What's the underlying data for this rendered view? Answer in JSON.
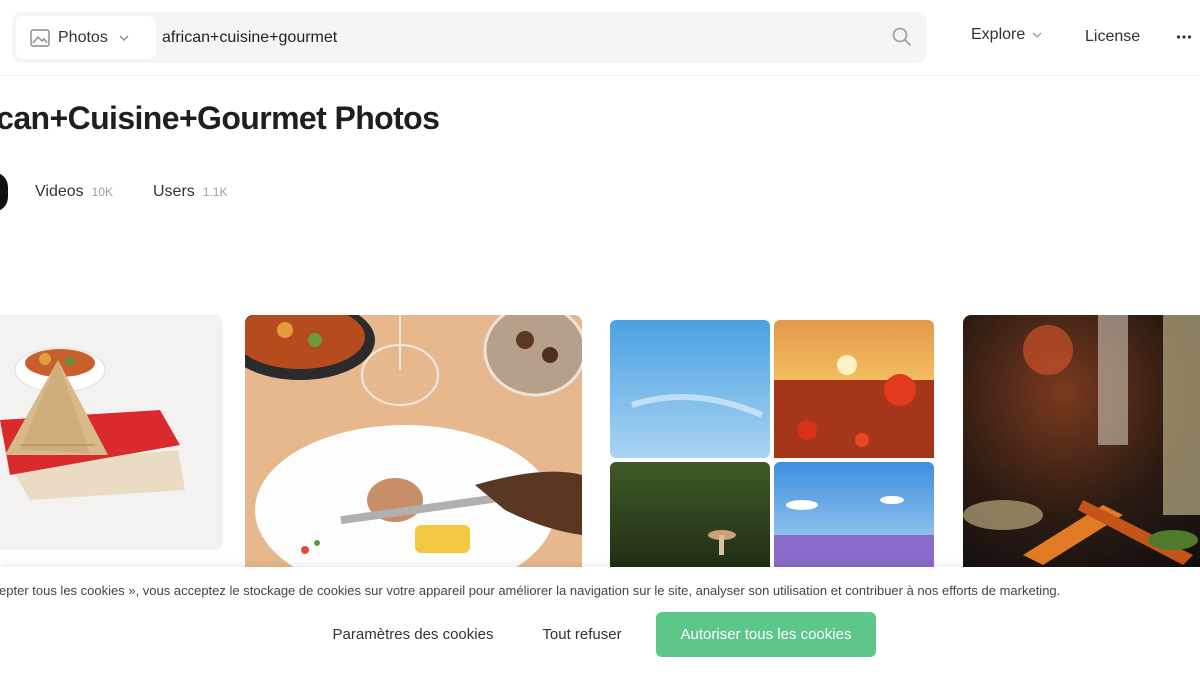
{
  "header": {
    "search_type": "Photos",
    "search_query": "african+cuisine+gourmet",
    "nav_explore": "Explore",
    "nav_license": "License"
  },
  "page": {
    "title": "rican+Cuisine+Gourmet Photos"
  },
  "tabs": [
    {
      "label": "Videos",
      "count": "10K"
    },
    {
      "label": "Users",
      "count": "1.1K"
    }
  ],
  "photos": [
    {
      "subject": "samosa on red plate"
    },
    {
      "subject": "cutting chicken on white plate"
    },
    {
      "subject": "collage sky poppies mushroom lavender"
    },
    {
      "subject": "gourmet dish with bokeh"
    }
  ],
  "cookie_banner": {
    "text": "ccepter tous les cookies », vous acceptez le stockage de cookies sur votre appareil pour améliorer la navigation sur le site, analyser son utilisation et contribuer à nos efforts de marketing.",
    "settings_label": "Paramètres des cookies",
    "refuse_label": "Tout refuser",
    "accept_label": "Autoriser tous les cookies"
  },
  "colors": {
    "accent_green": "#5dc68b",
    "search_bg": "#f5f5f5"
  }
}
